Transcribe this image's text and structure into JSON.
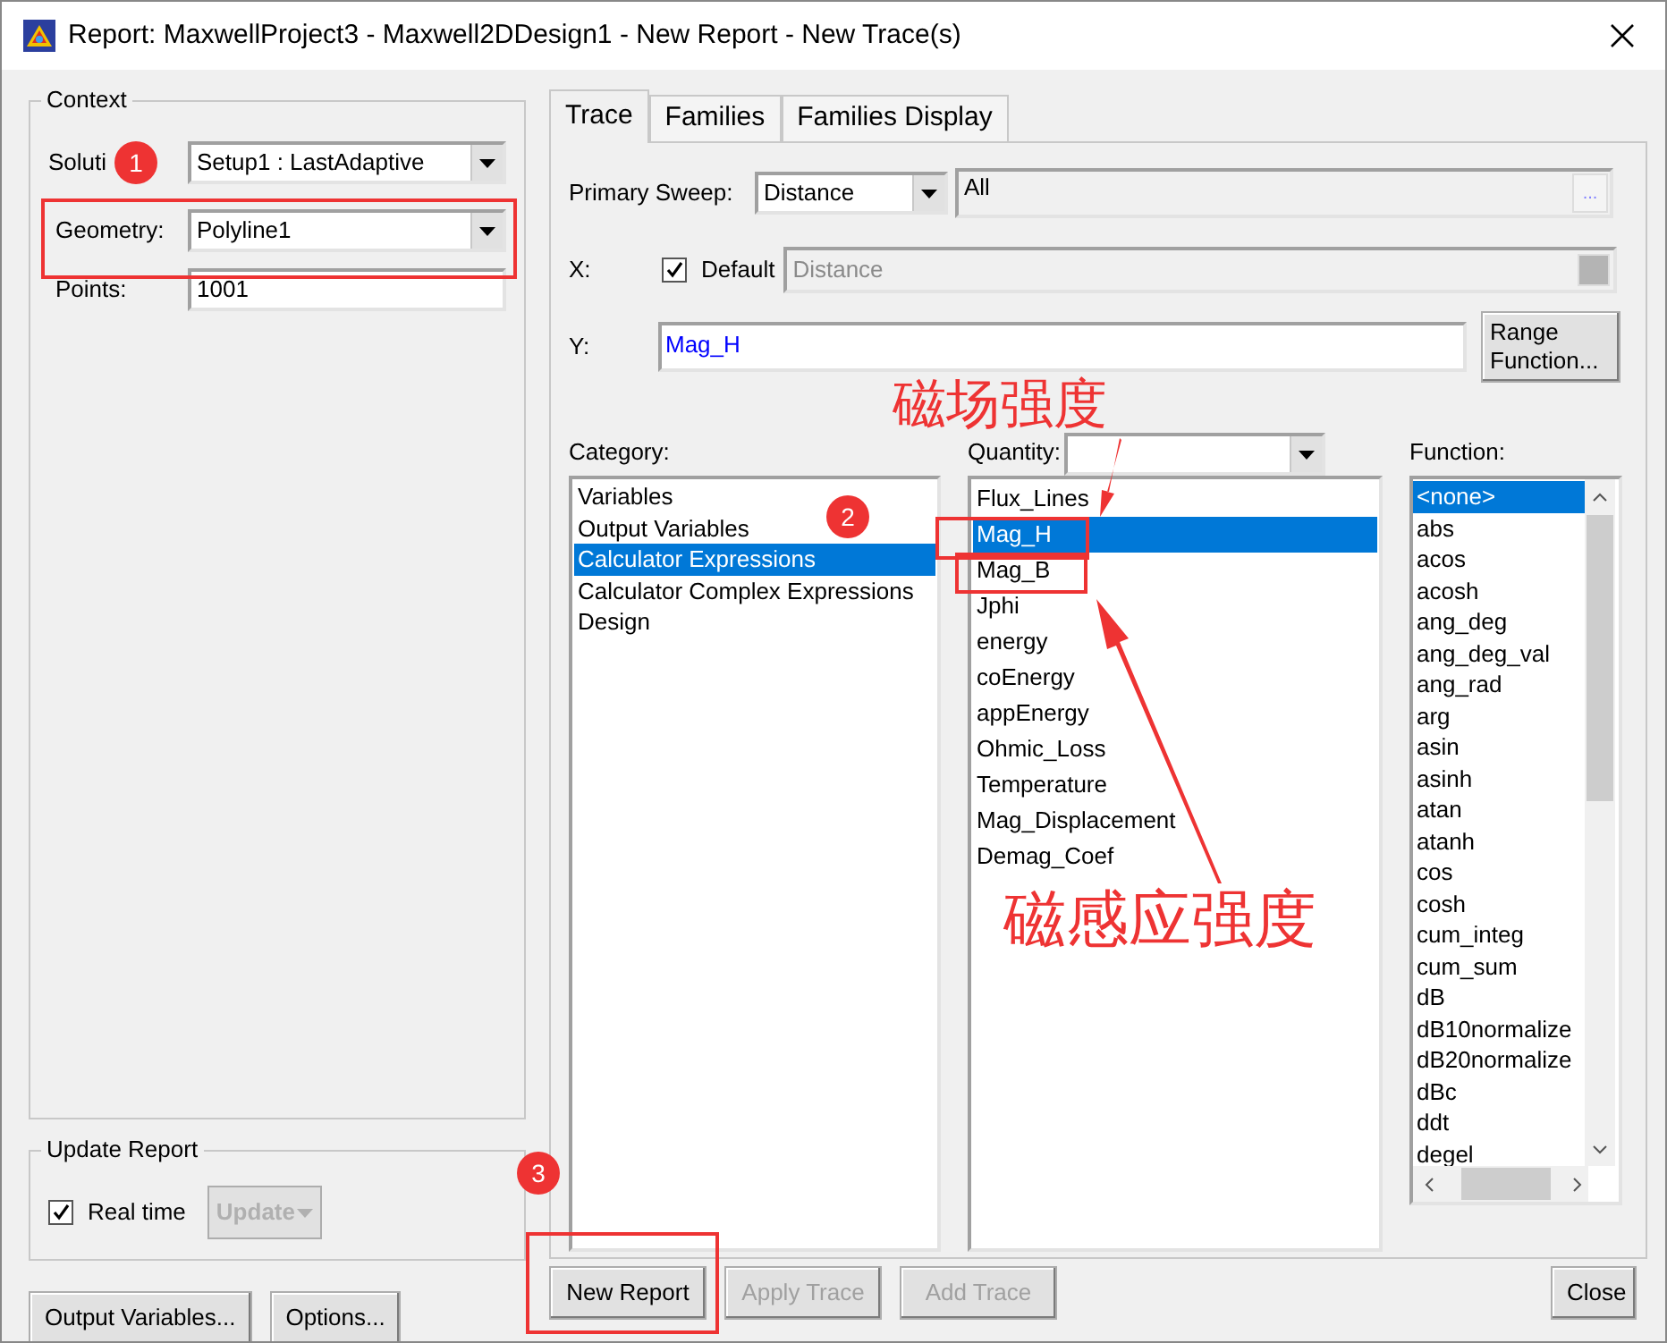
{
  "window": {
    "title": "Report: MaxwellProject3 - Maxwell2DDesign1 - New Report - New Trace(s)"
  },
  "context": {
    "legend": "Context",
    "solution_label": "Soluti",
    "solution_value": "Setup1 : LastAdaptive",
    "geometry_label": "Geometry:",
    "geometry_value": "Polyline1",
    "points_label": "Points:",
    "points_value": "1001"
  },
  "update_report": {
    "legend": "Update Report",
    "real_time": {
      "label": "Real time",
      "checked": true
    },
    "update_button": {
      "label": "Update",
      "disabled": true
    }
  },
  "left_buttons": [
    "Output Variables...",
    "Options..."
  ],
  "tabs": [
    {
      "label": "Trace",
      "selected": true
    },
    {
      "label": "Families",
      "selected": false
    },
    {
      "label": "Families Display",
      "selected": false
    }
  ],
  "trace": {
    "primary_sweep_label": "Primary Sweep:",
    "primary_sweep_value": "Distance",
    "range_value": "All",
    "range_button": "...",
    "x_label": "X:",
    "x_default": {
      "label": "Default",
      "checked": true
    },
    "x_value": "Distance",
    "y_label": "Y:",
    "y_value": "Mag_H",
    "range_function_button": "Range Function..."
  },
  "category": {
    "label": "Category:",
    "items": [
      {
        "label": "Variables",
        "selected": false
      },
      {
        "label": "Output Variables",
        "selected": false
      },
      {
        "label": "Calculator Expressions",
        "selected": true
      },
      {
        "label": "Calculator Complex Expressions",
        "selected": false
      },
      {
        "label": "Design",
        "selected": false
      }
    ]
  },
  "quantity": {
    "label": "Quantity:",
    "items": [
      {
        "label": "Flux_Lines",
        "selected": false
      },
      {
        "label": "Mag_H",
        "selected": true
      },
      {
        "label": "Mag_B",
        "selected": false
      },
      {
        "label": "Jphi",
        "selected": false
      },
      {
        "label": "energy",
        "selected": false
      },
      {
        "label": "coEnergy",
        "selected": false
      },
      {
        "label": "appEnergy",
        "selected": false
      },
      {
        "label": "Ohmic_Loss",
        "selected": false
      },
      {
        "label": "Temperature",
        "selected": false
      },
      {
        "label": "Mag_Displacement",
        "selected": false
      },
      {
        "label": "Demag_Coef",
        "selected": false
      }
    ]
  },
  "function": {
    "label": "Function:",
    "items": [
      {
        "label": "<none>",
        "selected": true
      },
      {
        "label": "abs",
        "selected": false
      },
      {
        "label": "acos",
        "selected": false
      },
      {
        "label": "acosh",
        "selected": false
      },
      {
        "label": "ang_deg",
        "selected": false
      },
      {
        "label": "ang_deg_val",
        "selected": false
      },
      {
        "label": "ang_rad",
        "selected": false
      },
      {
        "label": "arg",
        "selected": false
      },
      {
        "label": "asin",
        "selected": false
      },
      {
        "label": "asinh",
        "selected": false
      },
      {
        "label": "atan",
        "selected": false
      },
      {
        "label": "atanh",
        "selected": false
      },
      {
        "label": "cos",
        "selected": false
      },
      {
        "label": "cosh",
        "selected": false
      },
      {
        "label": "cum_integ",
        "selected": false
      },
      {
        "label": "cum_sum",
        "selected": false
      },
      {
        "label": "dB",
        "selected": false
      },
      {
        "label": "dB10normalize",
        "selected": false
      },
      {
        "label": "dB20normalize",
        "selected": false
      },
      {
        "label": "dBc",
        "selected": false
      },
      {
        "label": "ddt",
        "selected": false
      },
      {
        "label": "degel",
        "selected": false
      }
    ]
  },
  "bottom_buttons": [
    {
      "label": "New Report",
      "disabled": false
    },
    {
      "label": "Apply Trace",
      "disabled": true
    },
    {
      "label": "Add Trace",
      "disabled": true
    }
  ],
  "close_button": "Close",
  "annotations": {
    "markers": [
      "1",
      "2",
      "3"
    ],
    "notes": [
      "磁场强度",
      "磁感应强度"
    ]
  }
}
